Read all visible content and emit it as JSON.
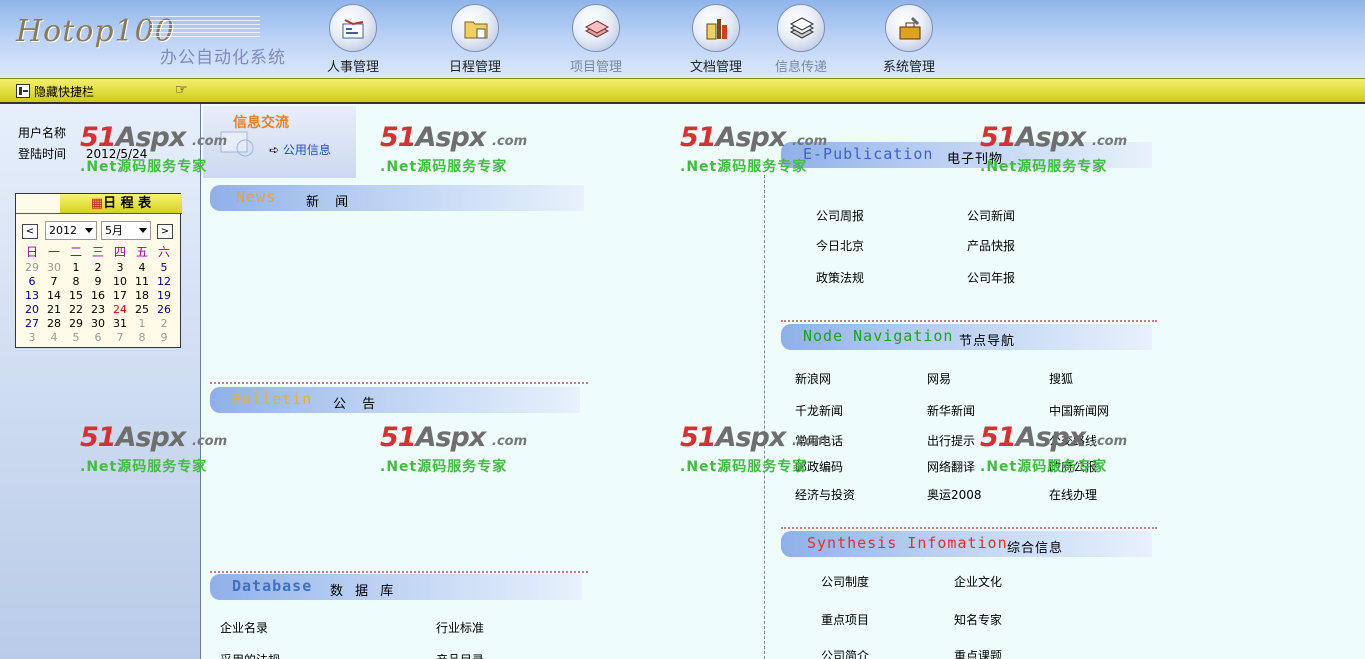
{
  "header": {
    "logo_text": "Hotop100",
    "system_name": "办公自动化系统",
    "nav": [
      {
        "label": "人事管理",
        "icon": "personnel-icon"
      },
      {
        "label": "日程管理",
        "icon": "folder-icon"
      },
      {
        "label": "项目管理",
        "icon": "stack-icon"
      },
      {
        "label": "文档管理",
        "icon": "documents-icon"
      },
      {
        "label": "信息传递",
        "icon": "papers-icon"
      },
      {
        "label": "系统管理",
        "icon": "toolbox-icon"
      }
    ]
  },
  "toolbar": {
    "toggle_label": "隐藏快捷栏",
    "hand_icon": "☞"
  },
  "sidebar": {
    "user_label": "用户名称",
    "login_label": "登陆时间",
    "login_value": "2012/5/24",
    "calendar": {
      "title": "日 程 表",
      "prev": "<",
      "next": ">",
      "year": "2012",
      "month": "5月",
      "weekdays": [
        "日",
        "一",
        "二",
        "三",
        "四",
        "五",
        "六"
      ],
      "weeks": [
        [
          "29",
          "30",
          "1",
          "2",
          "3",
          "4",
          "5"
        ],
        [
          "6",
          "7",
          "8",
          "9",
          "10",
          "11",
          "12"
        ],
        [
          "13",
          "14",
          "15",
          "16",
          "17",
          "18",
          "19"
        ],
        [
          "20",
          "21",
          "22",
          "23",
          "24",
          "25",
          "26"
        ],
        [
          "27",
          "28",
          "29",
          "30",
          "31",
          "1",
          "2"
        ],
        [
          "3",
          "4",
          "5",
          "6",
          "7",
          "8",
          "9"
        ]
      ],
      "today": "24"
    }
  },
  "info_tab": {
    "title": "信息交流",
    "link": "公用信息"
  },
  "sections": {
    "news": {
      "en": "News",
      "cn": "新 闻"
    },
    "bulletin": {
      "en": "Bulletin",
      "cn": "公 告"
    },
    "database": {
      "en": "Database",
      "cn": "数 据 库",
      "links": [
        "企业名录",
        "行业标准",
        "采用的法规",
        "产品目录"
      ]
    },
    "epub": {
      "en": "E-Publication",
      "cn": "电子刊物",
      "links": [
        "公司周报",
        "公司新闻",
        "今日北京",
        "产品快报",
        "政策法规",
        "公司年报"
      ]
    },
    "node": {
      "en": "Node Navigation",
      "cn": "节点导航",
      "links": [
        "新浪网",
        "网易",
        "搜狐",
        "千龙新闻",
        "新华新闻",
        "中国新闻网",
        "常用电话",
        "出行提示",
        "公交路线",
        "邮政编码",
        "网络翻译",
        "政府公报",
        "经济与投资",
        "奥运2008",
        "在线办理"
      ]
    },
    "synthesis": {
      "en": "Synthesis Infomation",
      "cn": "综合信息",
      "links": [
        "公司制度",
        "企业文化",
        "重点项目",
        "知名专家",
        "公司简介",
        "重点课题"
      ]
    }
  },
  "watermark": {
    "logo_a": "51",
    "logo_b": "Aspx",
    "com": ".com",
    "sub": ".Net源码服务专家"
  },
  "colors": {
    "news_en": "#e8a040",
    "bulletin_en": "#f0b020",
    "database_en": "#4070c0",
    "epub_en": "#4060d0",
    "node_en": "#20a020",
    "synthesis_en": "#e03030"
  }
}
